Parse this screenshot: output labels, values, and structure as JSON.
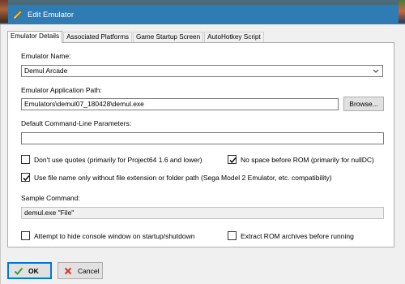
{
  "window": {
    "title": "Edit Emulator",
    "app_icon": "pencil-icon"
  },
  "tabs": [
    {
      "label": "Emulator Details",
      "active": true
    },
    {
      "label": "Associated Platforms",
      "active": false
    },
    {
      "label": "Game Startup Screen",
      "active": false
    },
    {
      "label": "AutoHotkey Script",
      "active": false
    }
  ],
  "form": {
    "name_label": "Emulator Name:",
    "name_value": "Demul Arcade",
    "path_label": "Emulator Application Path:",
    "path_value": "Emulators\\demul07_180428\\demul.exe",
    "browse_label": "Browse...",
    "params_label": "Default Command-Line Parameters:",
    "params_value": "",
    "sample_label": "Sample Command:",
    "sample_value": "demul.exe \"File\""
  },
  "checkboxes": {
    "no_quotes": {
      "label": "Don't use quotes (primarily for Project64 1.6 and lower)",
      "checked": false
    },
    "no_space": {
      "label": "No space before ROM (primarily for nullDC)",
      "checked": true
    },
    "file_name_only": {
      "label": "Use file name only without file extension or folder path (Sega Model 2 Emulator, etc. compatibility)",
      "checked": true
    },
    "hide_console": {
      "label": "Attempt to hide console window on startup/shutdown",
      "checked": false
    },
    "extract_rom": {
      "label": "Extract ROM archives before running",
      "checked": false
    }
  },
  "buttons": {
    "ok_label": "OK",
    "ok_icon": "checkmark-icon",
    "cancel_label": "Cancel",
    "cancel_icon": "cancel-icon"
  },
  "colors": {
    "titlebar": "#2f7bb4",
    "ok_check": "#2ea043",
    "cancel_red": "#d93025",
    "focus_border": "#0078d7"
  }
}
